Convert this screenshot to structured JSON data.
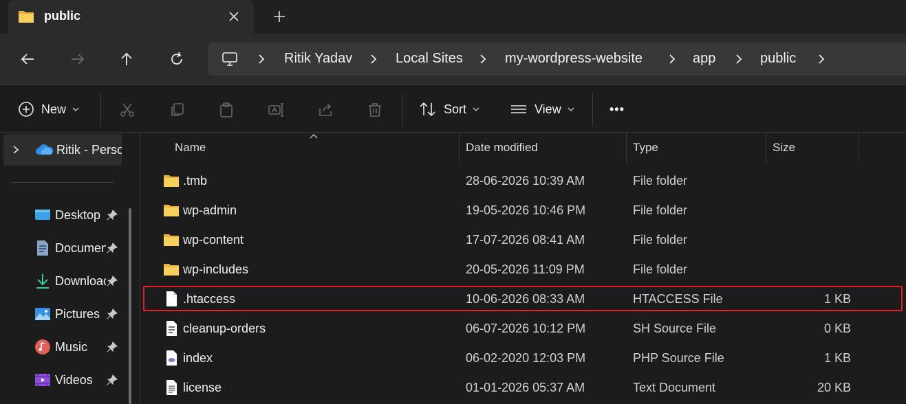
{
  "tab": {
    "title": "public",
    "folder_icon": "folder-icon",
    "close_icon": "close-icon",
    "add_icon": "plus-icon"
  },
  "nav": {
    "back_icon": "arrow-left-icon",
    "forward_icon": "arrow-right-icon",
    "up_icon": "arrow-up-icon",
    "refresh_icon": "refresh-icon",
    "breadcrumbs": [
      "Ritik Yadav",
      "Local Sites",
      "my-wordpress-website",
      "app",
      "public"
    ]
  },
  "toolbar": {
    "new_label": "New",
    "sort_label": "Sort",
    "view_label": "View",
    "more_label": "•••"
  },
  "sidebar": {
    "onedrive_label": "Ritik - Personal",
    "items": [
      {
        "label": "Desktop",
        "icon": "desktop-icon"
      },
      {
        "label": "Documents",
        "icon": "documents-icon"
      },
      {
        "label": "Downloads",
        "icon": "downloads-icon"
      },
      {
        "label": "Pictures",
        "icon": "pictures-icon"
      },
      {
        "label": "Music",
        "icon": "music-icon"
      },
      {
        "label": "Videos",
        "icon": "videos-icon"
      }
    ]
  },
  "columns": {
    "name": "Name",
    "date": "Date modified",
    "type": "Type",
    "size": "Size"
  },
  "files": [
    {
      "name": ".tmb",
      "date": "28-06-2026 10:39 AM",
      "type": "File folder",
      "size": "",
      "icon": "folder"
    },
    {
      "name": "wp-admin",
      "date": "19-05-2026 10:46 PM",
      "type": "File folder",
      "size": "",
      "icon": "folder"
    },
    {
      "name": "wp-content",
      "date": "17-07-2026 08:41 AM",
      "type": "File folder",
      "size": "",
      "icon": "folder"
    },
    {
      "name": "wp-includes",
      "date": "20-05-2026 11:09 PM",
      "type": "File folder",
      "size": "",
      "icon": "folder"
    },
    {
      "name": ".htaccess",
      "date": "10-06-2026 08:33 AM",
      "type": "HTACCESS File",
      "size": "1 KB",
      "icon": "file",
      "highlighted": true
    },
    {
      "name": "cleanup-orders",
      "date": "06-07-2026 10:12 PM",
      "type": "SH Source File",
      "size": "0 KB",
      "icon": "script"
    },
    {
      "name": "index",
      "date": "06-02-2020 12:03 PM",
      "type": "PHP Source File",
      "size": "1 KB",
      "icon": "php"
    },
    {
      "name": "license",
      "date": "01-01-2026 05:37 AM",
      "type": "Text Document",
      "size": "20 KB",
      "icon": "text"
    }
  ],
  "colors": {
    "highlight": "#e0202a",
    "folder": "#f2c14e",
    "accent": "#4aa3f0"
  }
}
